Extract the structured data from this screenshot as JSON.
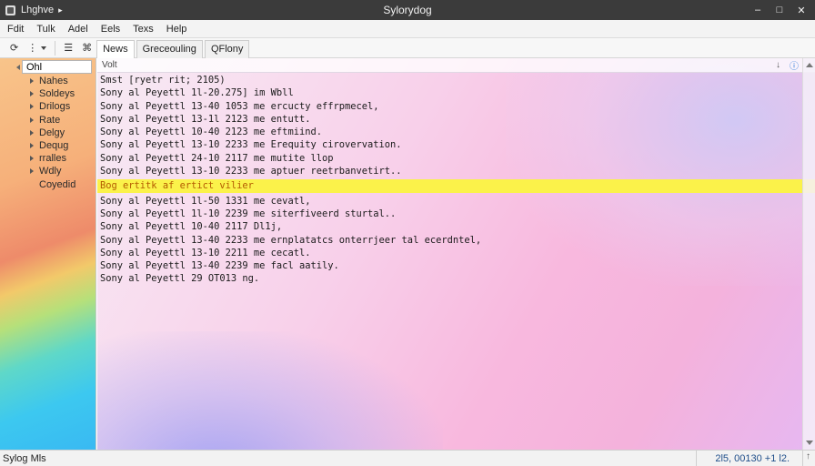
{
  "window": {
    "app_name": "Lhghve",
    "title": "Sylorydog",
    "buttons": {
      "minimize": "–",
      "maximize": "□",
      "close": "✕"
    }
  },
  "menu": [
    "Fdit",
    "Tulk",
    "Adel",
    "Eels",
    "Texs",
    "Help"
  ],
  "toolbar": {
    "tabs": [
      "News",
      "Greceouling",
      "QFlony"
    ]
  },
  "sidebar": {
    "search_value": "Ohl",
    "items": [
      {
        "label": "Nahes",
        "expandable": true
      },
      {
        "label": "Soldeys",
        "expandable": true
      },
      {
        "label": "Drilogs",
        "expandable": true
      },
      {
        "label": "Rate",
        "expandable": true
      },
      {
        "label": "Delgy",
        "expandable": true
      },
      {
        "label": "Dequg",
        "expandable": true
      },
      {
        "label": "rralles",
        "expandable": true
      },
      {
        "label": "Wdly",
        "expandable": true
      },
      {
        "label": "Coyedid",
        "expandable": false
      }
    ]
  },
  "log": {
    "column": "Volt",
    "lines": [
      "Smst [ryetr rit; 2105)",
      "Sony al Peyettl 1l-20.275] im Wbll",
      "Sony al Peyettl 13-40 1053 me ercucty effrpmecel,",
      "Sony al Peyettl 13-1l 2123 me entutt.",
      "Sony al Peyettl 10-40 2123 me eftmiind.",
      "Sony al Peyettl 13-10 2233 me Erequity cirovervation.",
      "Sony al Peyettl 24-10 2117 me mutite llop",
      "Sony al Peyettl 13-10 2233 me aptuer reetrbanvetirt..",
      "Bog ertitk af ertict vilier",
      "Sony al Peyettl 1l-50 1331 me cevatl,",
      "Sony al Peyettl 1l-10 2239 me siterfiveerd sturtal..",
      "Sony al Peyettl 10-40 2117 Dl1j,",
      "Sony al Peyettl 13-40 2233 me ernplatatcs onterrjeer tal ecerdntel,",
      "Sony al Peyettl 13-10 2211 me cecatl.",
      "Sony al Peyettl 13-40 2239 me facl aatily.",
      "Sony al Peyettl 29 OT013 ng."
    ],
    "highlight_index": 8
  },
  "status": {
    "left": "Sylog Mls",
    "position": "2l5, 00130 +1 l2."
  },
  "colors": {
    "highlight": "#fbf24a",
    "highlight_text": "#b45a00",
    "titlebar": "#3b3b3b"
  }
}
